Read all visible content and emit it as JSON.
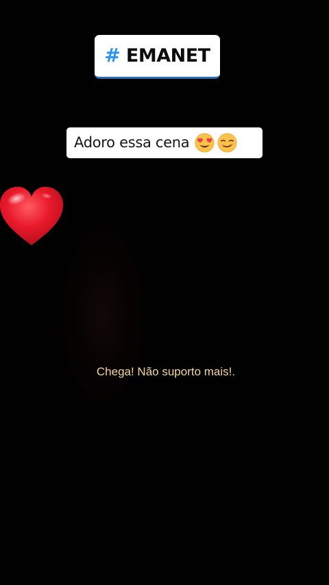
{
  "hashtag": {
    "symbol": "#",
    "text": "EMANET",
    "symbol_color": "#2b93f0",
    "underline_color": "#2f6fb7"
  },
  "caption": {
    "text": "Adoro essa cena",
    "emojis": [
      "heart-eyes-emoji",
      "smirk-emoji"
    ]
  },
  "decoration": {
    "icon": "red-heart-icon",
    "color": "#e01a2a"
  },
  "subtitle": {
    "text": "Chega! Não suporto mais!.",
    "color": "#f3d79a"
  },
  "colors": {
    "background": "#020101"
  }
}
